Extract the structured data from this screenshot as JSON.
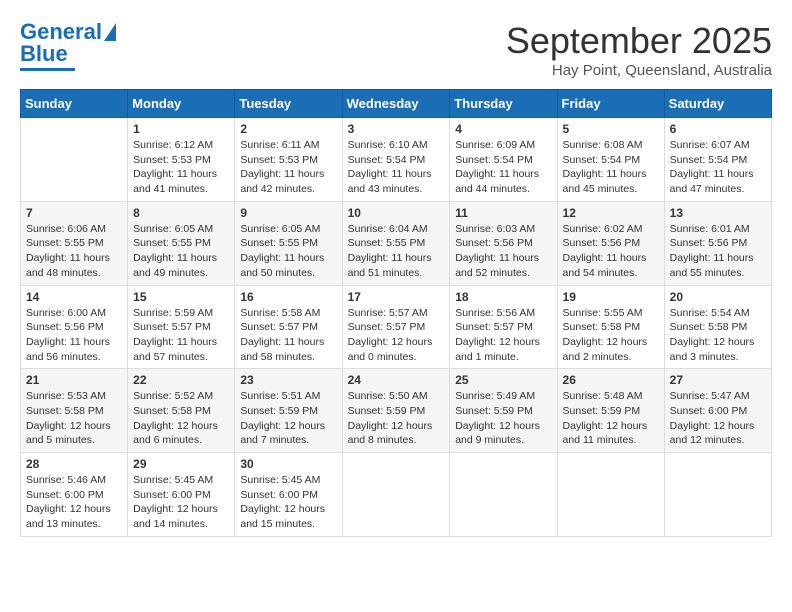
{
  "header": {
    "logo_line1": "General",
    "logo_line2": "Blue",
    "month": "September 2025",
    "location": "Hay Point, Queensland, Australia"
  },
  "weekdays": [
    "Sunday",
    "Monday",
    "Tuesday",
    "Wednesday",
    "Thursday",
    "Friday",
    "Saturday"
  ],
  "weeks": [
    [
      {
        "day": "",
        "sunrise": "",
        "sunset": "",
        "daylight": ""
      },
      {
        "day": "1",
        "sunrise": "Sunrise: 6:12 AM",
        "sunset": "Sunset: 5:53 PM",
        "daylight": "Daylight: 11 hours and 41 minutes."
      },
      {
        "day": "2",
        "sunrise": "Sunrise: 6:11 AM",
        "sunset": "Sunset: 5:53 PM",
        "daylight": "Daylight: 11 hours and 42 minutes."
      },
      {
        "day": "3",
        "sunrise": "Sunrise: 6:10 AM",
        "sunset": "Sunset: 5:54 PM",
        "daylight": "Daylight: 11 hours and 43 minutes."
      },
      {
        "day": "4",
        "sunrise": "Sunrise: 6:09 AM",
        "sunset": "Sunset: 5:54 PM",
        "daylight": "Daylight: 11 hours and 44 minutes."
      },
      {
        "day": "5",
        "sunrise": "Sunrise: 6:08 AM",
        "sunset": "Sunset: 5:54 PM",
        "daylight": "Daylight: 11 hours and 45 minutes."
      },
      {
        "day": "6",
        "sunrise": "Sunrise: 6:07 AM",
        "sunset": "Sunset: 5:54 PM",
        "daylight": "Daylight: 11 hours and 47 minutes."
      }
    ],
    [
      {
        "day": "7",
        "sunrise": "Sunrise: 6:06 AM",
        "sunset": "Sunset: 5:55 PM",
        "daylight": "Daylight: 11 hours and 48 minutes."
      },
      {
        "day": "8",
        "sunrise": "Sunrise: 6:05 AM",
        "sunset": "Sunset: 5:55 PM",
        "daylight": "Daylight: 11 hours and 49 minutes."
      },
      {
        "day": "9",
        "sunrise": "Sunrise: 6:05 AM",
        "sunset": "Sunset: 5:55 PM",
        "daylight": "Daylight: 11 hours and 50 minutes."
      },
      {
        "day": "10",
        "sunrise": "Sunrise: 6:04 AM",
        "sunset": "Sunset: 5:55 PM",
        "daylight": "Daylight: 11 hours and 51 minutes."
      },
      {
        "day": "11",
        "sunrise": "Sunrise: 6:03 AM",
        "sunset": "Sunset: 5:56 PM",
        "daylight": "Daylight: 11 hours and 52 minutes."
      },
      {
        "day": "12",
        "sunrise": "Sunrise: 6:02 AM",
        "sunset": "Sunset: 5:56 PM",
        "daylight": "Daylight: 11 hours and 54 minutes."
      },
      {
        "day": "13",
        "sunrise": "Sunrise: 6:01 AM",
        "sunset": "Sunset: 5:56 PM",
        "daylight": "Daylight: 11 hours and 55 minutes."
      }
    ],
    [
      {
        "day": "14",
        "sunrise": "Sunrise: 6:00 AM",
        "sunset": "Sunset: 5:56 PM",
        "daylight": "Daylight: 11 hours and 56 minutes."
      },
      {
        "day": "15",
        "sunrise": "Sunrise: 5:59 AM",
        "sunset": "Sunset: 5:57 PM",
        "daylight": "Daylight: 11 hours and 57 minutes."
      },
      {
        "day": "16",
        "sunrise": "Sunrise: 5:58 AM",
        "sunset": "Sunset: 5:57 PM",
        "daylight": "Daylight: 11 hours and 58 minutes."
      },
      {
        "day": "17",
        "sunrise": "Sunrise: 5:57 AM",
        "sunset": "Sunset: 5:57 PM",
        "daylight": "Daylight: 12 hours and 0 minutes."
      },
      {
        "day": "18",
        "sunrise": "Sunrise: 5:56 AM",
        "sunset": "Sunset: 5:57 PM",
        "daylight": "Daylight: 12 hours and 1 minute."
      },
      {
        "day": "19",
        "sunrise": "Sunrise: 5:55 AM",
        "sunset": "Sunset: 5:58 PM",
        "daylight": "Daylight: 12 hours and 2 minutes."
      },
      {
        "day": "20",
        "sunrise": "Sunrise: 5:54 AM",
        "sunset": "Sunset: 5:58 PM",
        "daylight": "Daylight: 12 hours and 3 minutes."
      }
    ],
    [
      {
        "day": "21",
        "sunrise": "Sunrise: 5:53 AM",
        "sunset": "Sunset: 5:58 PM",
        "daylight": "Daylight: 12 hours and 5 minutes."
      },
      {
        "day": "22",
        "sunrise": "Sunrise: 5:52 AM",
        "sunset": "Sunset: 5:58 PM",
        "daylight": "Daylight: 12 hours and 6 minutes."
      },
      {
        "day": "23",
        "sunrise": "Sunrise: 5:51 AM",
        "sunset": "Sunset: 5:59 PM",
        "daylight": "Daylight: 12 hours and 7 minutes."
      },
      {
        "day": "24",
        "sunrise": "Sunrise: 5:50 AM",
        "sunset": "Sunset: 5:59 PM",
        "daylight": "Daylight: 12 hours and 8 minutes."
      },
      {
        "day": "25",
        "sunrise": "Sunrise: 5:49 AM",
        "sunset": "Sunset: 5:59 PM",
        "daylight": "Daylight: 12 hours and 9 minutes."
      },
      {
        "day": "26",
        "sunrise": "Sunrise: 5:48 AM",
        "sunset": "Sunset: 5:59 PM",
        "daylight": "Daylight: 12 hours and 11 minutes."
      },
      {
        "day": "27",
        "sunrise": "Sunrise: 5:47 AM",
        "sunset": "Sunset: 6:00 PM",
        "daylight": "Daylight: 12 hours and 12 minutes."
      }
    ],
    [
      {
        "day": "28",
        "sunrise": "Sunrise: 5:46 AM",
        "sunset": "Sunset: 6:00 PM",
        "daylight": "Daylight: 12 hours and 13 minutes."
      },
      {
        "day": "29",
        "sunrise": "Sunrise: 5:45 AM",
        "sunset": "Sunset: 6:00 PM",
        "daylight": "Daylight: 12 hours and 14 minutes."
      },
      {
        "day": "30",
        "sunrise": "Sunrise: 5:45 AM",
        "sunset": "Sunset: 6:00 PM",
        "daylight": "Daylight: 12 hours and 15 minutes."
      },
      {
        "day": "",
        "sunrise": "",
        "sunset": "",
        "daylight": ""
      },
      {
        "day": "",
        "sunrise": "",
        "sunset": "",
        "daylight": ""
      },
      {
        "day": "",
        "sunrise": "",
        "sunset": "",
        "daylight": ""
      },
      {
        "day": "",
        "sunrise": "",
        "sunset": "",
        "daylight": ""
      }
    ]
  ]
}
